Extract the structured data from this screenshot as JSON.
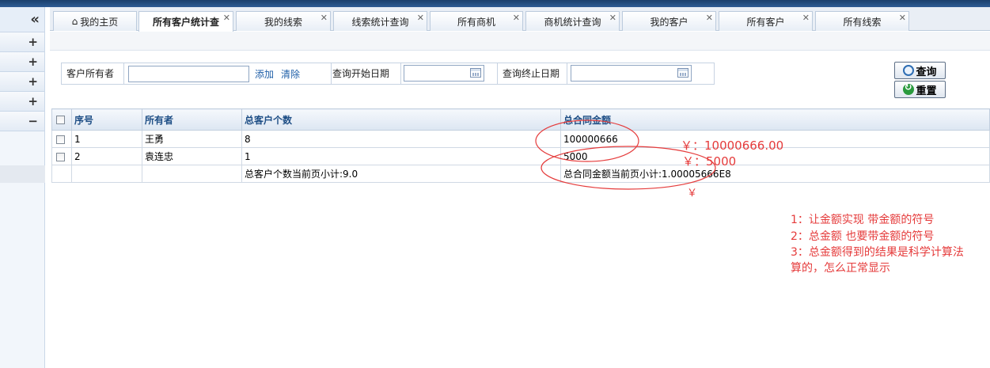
{
  "sidebar": {
    "collapse_glyph": "«",
    "items": [
      {
        "glyph": "+"
      },
      {
        "glyph": "+"
      },
      {
        "glyph": "+"
      },
      {
        "glyph": "+"
      },
      {
        "glyph": "−"
      }
    ]
  },
  "tabs": [
    {
      "label": "我的主页",
      "icon": "home-icon",
      "close": ""
    },
    {
      "label": "所有客户统计查",
      "close": "✕",
      "active": true
    },
    {
      "label": "我的线索",
      "close": "✕"
    },
    {
      "label": "线索统计查询",
      "close": "✕"
    },
    {
      "label": "所有商机",
      "close": "✕"
    },
    {
      "label": "商机统计查询",
      "close": "✕"
    },
    {
      "label": "我的客户",
      "close": "✕"
    },
    {
      "label": "所有客户",
      "close": "✕"
    },
    {
      "label": "所有线索",
      "close": "✕"
    }
  ],
  "search": {
    "owner_label": "客户所有者",
    "owner_value": "",
    "add_link": "添加",
    "clear_link": "清除",
    "start_label": "查询开始日期",
    "start_value": "",
    "end_label": "查询终止日期",
    "end_value": ""
  },
  "buttons": {
    "query": "查询",
    "reset": "重置"
  },
  "table": {
    "headers": [
      "序号",
      "所有者",
      "总客户个数",
      "总合同金额"
    ],
    "rows": [
      {
        "index": "1",
        "owner": "王勇",
        "count": "8",
        "amount": "100000666"
      },
      {
        "index": "2",
        "owner": "袁连忠",
        "count": "1",
        "amount": "5000"
      }
    ],
    "summary": {
      "count": "总客户个数当前页小计:9.0",
      "amount": "总合同金额当前页小计:1.00005666E8"
    }
  },
  "annotations": {
    "a1": "￥：10000666.00",
    "a2": "￥：5000",
    "a3": "￥",
    "notes": [
      "1：让金额实现 带金额的符号",
      "2：总金额 也要带金额的符号",
      "3：总金额得到的结果是科学计算法",
      "算的，怎么正常显示"
    ],
    "color": "#e53b3b"
  }
}
